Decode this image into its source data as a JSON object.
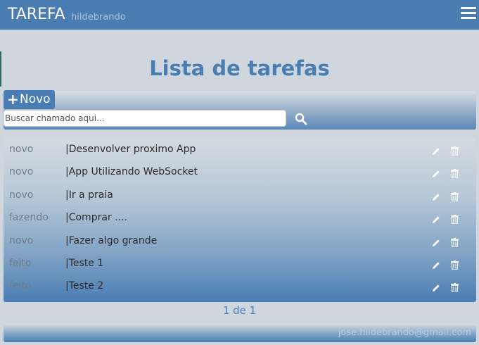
{
  "header": {
    "brand": "TAREFA",
    "user": "hildebrando",
    "menu_icon": "hamburger-menu-icon"
  },
  "page": {
    "title": "Lista de tarefas"
  },
  "toolbar": {
    "new_label": "Novo",
    "new_icon": "plus-icon",
    "search_placeholder": "Buscar chamado aqui...",
    "search_icon": "magnifier-icon"
  },
  "tasks": [
    {
      "status": "novo",
      "title": "|Desenvolver proximo App"
    },
    {
      "status": "novo",
      "title": "|App Utilizando WebSocket"
    },
    {
      "status": "novo",
      "title": "|Ir a praia"
    },
    {
      "status": "fazendo",
      "title": "|Comprar ...."
    },
    {
      "status": "novo",
      "title": "|Fazer algo grande"
    },
    {
      "status": "feito",
      "title": "|Teste 1"
    },
    {
      "status": "feito",
      "title": "|Teste 2"
    }
  ],
  "row_actions": {
    "edit_icon": "pencil-icon",
    "delete_icon": "trash-icon"
  },
  "pagination": {
    "text": "1 de 1"
  },
  "footer": {
    "email": "jose.hildebrando@gmail.com"
  }
}
